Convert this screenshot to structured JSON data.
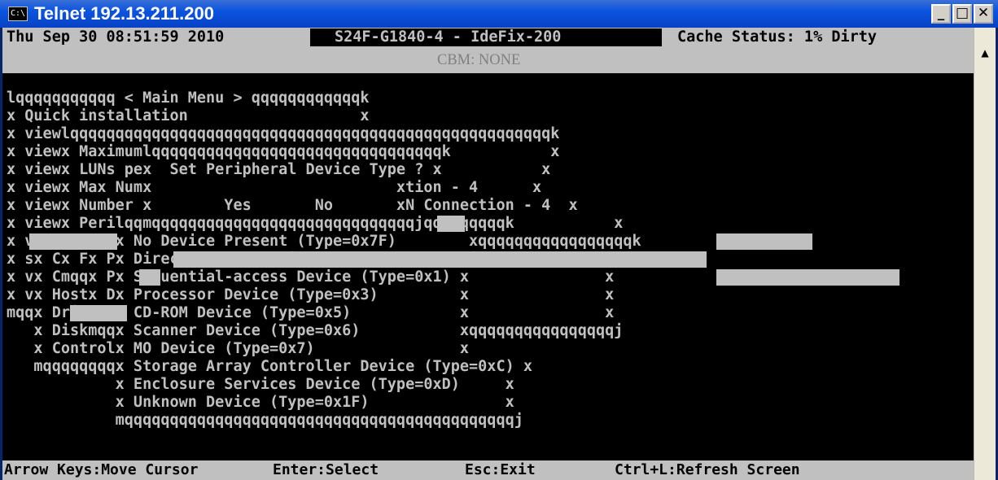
{
  "window": {
    "title": "Telnet 192.13.211.200",
    "icon": "C:\\",
    "buttons": {
      "minimize": "_",
      "maximize": "□",
      "close": "✕"
    }
  },
  "header": {
    "datetime": "Thu Sep 30 08:51:59 2010",
    "host": "S24F-G1840-4 - IdeFix-200",
    "cache": "Cache Status: 1% Dirty"
  },
  "cbm": "CBM: NONE",
  "screen_lines": [
    "lqqqqqqqqqqq < Main Menu > qqqqqqqqqqqqk",
    "x Quick installation                   x",
    "x viewlqqqqqqqqqqqqqqqqqqqqqqqqqqqqqqqqqqqqqqqqqqqqqqqqqqqqqk",
    "x viewx Maximumlqqqqqqqqqqqqqqqqqqqqqqqqqqqqqqqqk           x",
    "x viewx LUNs pex  Set Peripheral Device Type ? x           x",
    "x viewx Max Numx                           xtion - 4      x",
    "x viewx Number x        Yes       No       xN Connection - 4  x",
    "x viewx Perilqqmqqqqqqqqqqqqqqqqqqqqqqqqqqqqqjqqqqqqqqqk           x",
    "x vlqqx Clqqx No Device Present (Type=0x7F)        xqqqqqqqqqqqqqqqqqk",
    "x sx Cx Fx Px Direct-access Device (Type=0x0)     xice (Type=0xD) x",
    "x vx Cmqqx Px Sequential-access Device (Type=0x1) x               x",
    "x vx Hostx Dx Processor Device (Type=0x3)         x               x",
    "mqqx Drivx Lx CD-ROM Device (Type=0x5)            x               x",
    "   x Diskmqqx Scanner Device (Type=0x6)           xqqqqqqqqqqqqqqqqj",
    "   x Controlx MO Device (Type=0x7)                x",
    "   mqqqqqqqqx Storage Array Controller Device (Type=0xC) x",
    "            x Enclosure Services Device (Type=0xD)     x",
    "            x Unknown Device (Type=0x1F)               x",
    "            mqqqqqqqqqqqqqqqqqqqqqqqqqqqqqqqqqqqqqqqqqqqj"
  ],
  "status_bar": {
    "move": "Arrow Keys:Move Cursor",
    "select": "Enter:Select",
    "exit": "Esc:Exit",
    "refresh": "Ctrl+L:Refresh Screen"
  }
}
